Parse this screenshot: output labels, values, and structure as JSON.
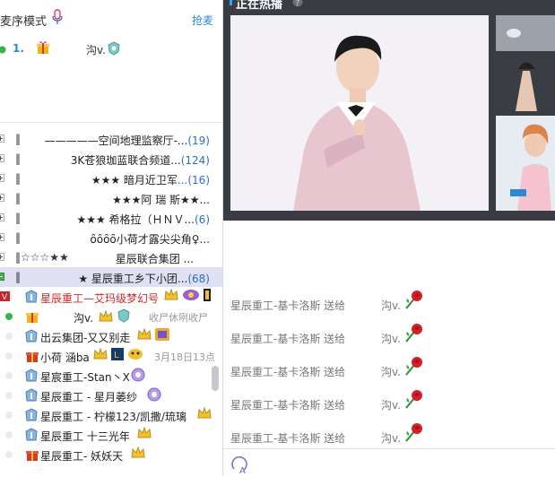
{
  "mic_panel": {
    "mode_label": "麦序模式",
    "grab_link": "抢麦",
    "queue": [
      {
        "num": "1.",
        "user": "沟v."
      }
    ]
  },
  "channels": [
    {
      "bar": "‖",
      "name": "—————空间地理监察厅-...",
      "count": "(19)",
      "active": false
    },
    {
      "bar": "‖",
      "name": "3K苍狼珈蓝联合频道...",
      "count": "(124)",
      "active": false
    },
    {
      "bar": "‖",
      "name": "★★★  暗月近卫军",
      "count": "...(16)",
      "active": false
    },
    {
      "bar": "‖",
      "name": "★★★阿 瑞 斯★★...",
      "count": "",
      "active": false
    },
    {
      "bar": "‖",
      "name": "★★★   希格拉（ＨＮＶ...",
      "count": "(6)",
      "active": false
    },
    {
      "bar": "‖",
      "name": "ȏȏȏȏ小荷才露尖尖角♀...",
      "count": "",
      "active": false
    },
    {
      "bar": "‖☆☆☆★★",
      "name": "星辰联合集团    ...",
      "count": "",
      "active": false
    },
    {
      "bar": "‖",
      "name": "★      星辰重工乡下小团...",
      "count": "(68)",
      "active": true
    }
  ],
  "users": [
    {
      "name": "星辰重工—艾玛级梦幻号",
      "red": true,
      "extra": ""
    },
    {
      "name": "沟v.",
      "red": false,
      "extra": "收尸休咧收尸"
    },
    {
      "name": "出云集团-又又别走",
      "red": false,
      "extra": ""
    },
    {
      "name": "小荷 涵ba",
      "red": false,
      "extra": "3月18日13点"
    },
    {
      "name": "星宸重工-Stan丶X",
      "red": false,
      "extra": ""
    },
    {
      "name": "星辰重工 - 星月萎纱",
      "red": false,
      "extra": ""
    },
    {
      "name": "星辰重工 - 柠檬123/凯撒/琉璃",
      "red": false,
      "extra": ""
    },
    {
      "name": "星辰重工 十三光年",
      "red": false,
      "extra": ""
    },
    {
      "name": "星辰重工- 妖妖天",
      "red": false,
      "extra": ""
    }
  ],
  "hot_panel": {
    "title": "正在热播"
  },
  "gifts": [
    {
      "sender": "星辰重工-基卡洛斯 送给",
      "receiver": "沟v."
    },
    {
      "sender": "星辰重工-基卡洛斯 送给",
      "receiver": "沟v."
    },
    {
      "sender": "星辰重工-基卡洛斯 送给",
      "receiver": "沟v."
    },
    {
      "sender": "星辰重工-基卡洛斯 送给",
      "receiver": "沟v."
    },
    {
      "sender": "星辰重工-基卡洛斯 送给",
      "receiver": "沟v."
    }
  ],
  "colors": {
    "accent": "#2a8ad3",
    "online": "#3bb34a",
    "vip_red": "#d12828",
    "panel_dark": "#3a3c44"
  },
  "icons": [
    "mic-icon",
    "gift-icon",
    "shield-badge-icon",
    "crown-icon",
    "rose-icon",
    "help-icon",
    "font-icon",
    "vip-badge-icon"
  ]
}
